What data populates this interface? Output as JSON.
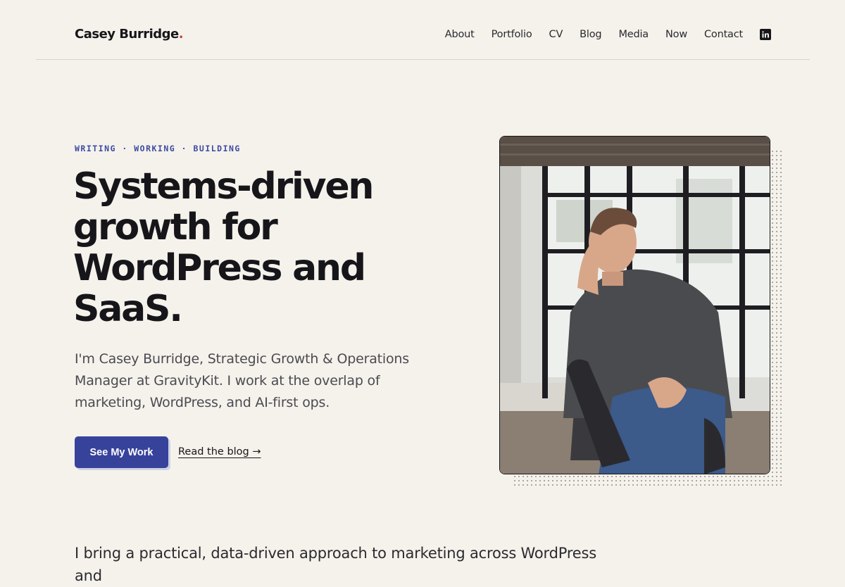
{
  "header": {
    "brand_name": "Casey Burridge",
    "brand_dot": ".",
    "nav": [
      "About",
      "Portfolio",
      "CV",
      "Blog",
      "Media",
      "Now",
      "Contact"
    ],
    "linkedin_icon": "linkedin-icon"
  },
  "hero": {
    "eyebrow": "WRITING · WORKING · BUILDING",
    "headline": "Systems-driven growth for WordPress and SaaS.",
    "intro": "I'm Casey Burridge, Strategic Growth & Operations Manager at GravityKit. I work at the overlap of marketing, WordPress, and AI-first ops.",
    "primary_button": "See My Work",
    "secondary_link": "Read the blog →"
  },
  "lower": {
    "text": "I bring a practical, data-driven approach to marketing across WordPress and"
  },
  "colors": {
    "background": "#f5f2eb",
    "accent": "#37439b",
    "brand_dot": "#c0443b"
  }
}
